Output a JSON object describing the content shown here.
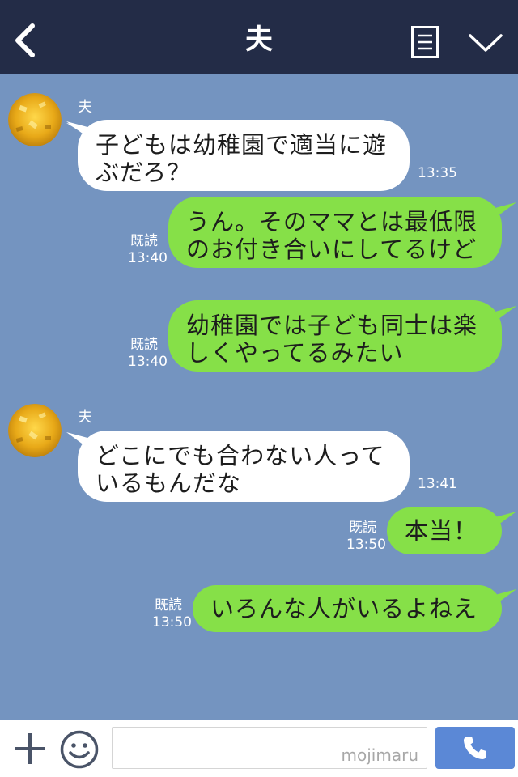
{
  "header": {
    "title": "夫"
  },
  "messages": [
    {
      "sender": "夫",
      "text": "子どもは幼稚園で適当に遊\nぶだろ？",
      "time": "13:35"
    },
    {
      "text": "うん。そのママとは最低限\nのお付き合いにしてるけど",
      "read": "既読",
      "time": "13:40"
    },
    {
      "text": "幼稚園では子ども同士は楽\nしくやってるみたい",
      "read": "既読",
      "time": "13:40"
    },
    {
      "sender": "夫",
      "text": "どこにでも合わない人って\nいるもんだな",
      "time": "13:41"
    },
    {
      "text": "本当！",
      "read": "既読",
      "time": "13:50"
    },
    {
      "text": "いろんな人がいるよねえ",
      "read": "既読",
      "time": "13:50"
    }
  ],
  "footer": {
    "watermark": "mojimaru"
  },
  "colors": {
    "header": "#232c47",
    "background": "#7494c0",
    "outgoing": "#86e048",
    "incoming": "#ffffff",
    "call": "#5b88d6"
  },
  "icons": [
    "back-icon",
    "menu-icon",
    "chevron-down-icon",
    "plus-icon",
    "smile-icon",
    "phone-icon"
  ]
}
